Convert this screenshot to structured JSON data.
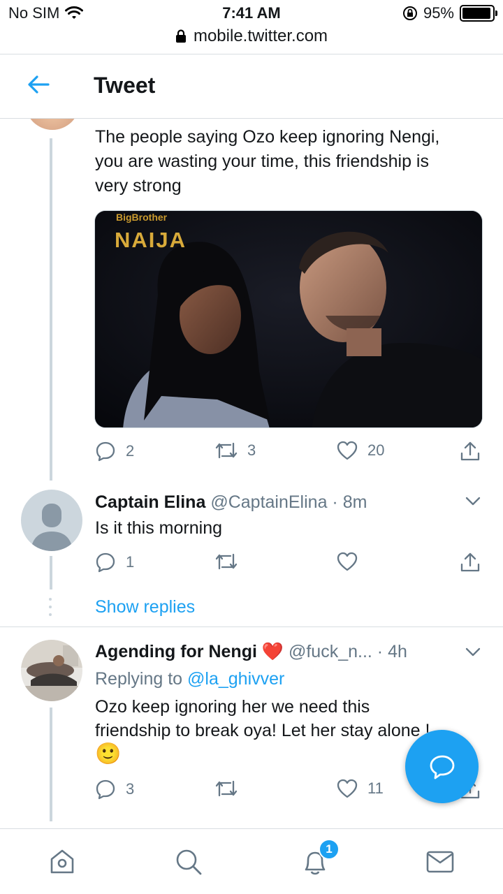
{
  "status_bar": {
    "carrier": "No SIM",
    "time": "7:41 AM",
    "battery": "95%",
    "battery_level": 0.95
  },
  "address_bar": {
    "url": "mobile.twitter.com"
  },
  "header": {
    "title": "Tweet"
  },
  "main_tweet": {
    "text_lines": [
      "The people saying Ozo keep ignoring Nengi,",
      "you are wasting your time,  this friendship is",
      "very strong"
    ],
    "media_watermark_top": "BigBrother",
    "media_watermark": "NAIJA",
    "reply_count": "2",
    "retweet_count": "3",
    "like_count": "20"
  },
  "reply_1": {
    "name": "Captain Elina",
    "handle": "@CaptainElina",
    "time": "· 8m",
    "text": "Is it this morning",
    "reply_count": "1",
    "retweet_count": "",
    "like_count": "",
    "show_replies": "Show replies"
  },
  "reply_2": {
    "name": "Agending for Nengi",
    "name_emoji": "❤️",
    "handle": "@fuck_n...",
    "time": "· 4h",
    "replying_prefix": "Replying to",
    "replying_to": "@la_ghivver",
    "text_lines": [
      "Ozo keep ignoring her we need this",
      "friendship to break oya! Let her stay alone !"
    ],
    "emoji": "🙂",
    "reply_count": "3",
    "retweet_count": "",
    "like_count": "11"
  },
  "bottom_nav": {
    "notification_badge": "1"
  },
  "colors": {
    "accent": "#1da1f2",
    "text": "#14171a",
    "muted": "#657786",
    "like_heart": "#e0245e"
  }
}
